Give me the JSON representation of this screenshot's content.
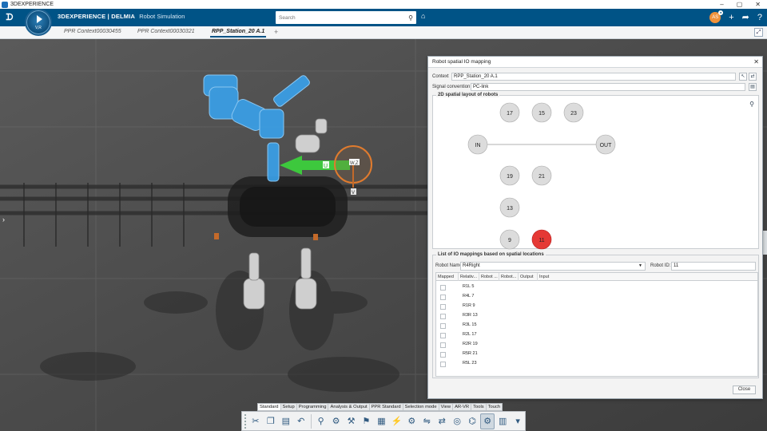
{
  "os": {
    "title": "3DEXPERIENCE",
    "min": "–",
    "max": "▢",
    "close": "✕"
  },
  "header": {
    "logo": "3DS",
    "brand_bold": "3DEXPERIENCE | DELMIA",
    "app_name": "Robot Simulation",
    "compass_label": "V,R",
    "search_placeholder": "Search",
    "avatar_initials": "AS",
    "icons": [
      "search-icon",
      "tag-icon",
      "add-icon",
      "share-icon",
      "help-icon"
    ]
  },
  "tabs": [
    {
      "label": "PPR Context00030455",
      "active": false
    },
    {
      "label": "PPR Context00030321",
      "active": false
    },
    {
      "label": "RPP_Station_20 A.1",
      "active": true
    }
  ],
  "viewport": {
    "arrow_label_left": "U",
    "arrow_label_right": "W,Z",
    "compass_label_below": "V"
  },
  "dialog": {
    "title": "Robot spatial IO mapping",
    "context_label": "Context",
    "context_value": "RPP_Station_20 A.1",
    "convention_label": "Signal convention",
    "convention_value": "PC-link",
    "layout_title": "2D spatial layout of robots",
    "nodes": [
      {
        "label": "17",
        "selected": false
      },
      {
        "label": "15",
        "selected": false
      },
      {
        "label": "23",
        "selected": false
      },
      {
        "label": "IN",
        "selected": false
      },
      {
        "label": "OUT",
        "selected": false
      },
      {
        "label": "19",
        "selected": false
      },
      {
        "label": "21",
        "selected": false
      },
      {
        "label": "13",
        "selected": false
      },
      {
        "label": "9",
        "selected": false
      },
      {
        "label": "11",
        "selected": true
      }
    ],
    "list_title": "List of IO mappings based on spatial locations",
    "robot_name_label": "Robot Name",
    "robot_name_value": "R4Right",
    "robot_id_label": "Robot ID:",
    "robot_id_value": "11",
    "columns": [
      "Mapped",
      "Relativ...",
      "Robot ...",
      "Robot...",
      "Output",
      "Input"
    ],
    "rows": [
      {
        "robot": "R1L",
        "id": "5",
        "mapped": false
      },
      {
        "robot": "R4L",
        "id": "7",
        "mapped": false
      },
      {
        "robot": "R1R",
        "id": "9",
        "mapped": false
      },
      {
        "robot": "R3R",
        "id": "13",
        "mapped": false
      },
      {
        "robot": "R3L",
        "id": "15",
        "mapped": false
      },
      {
        "robot": "R2L",
        "id": "17",
        "mapped": false
      },
      {
        "robot": "R2R",
        "id": "19",
        "mapped": false
      },
      {
        "robot": "R5R",
        "id": "21",
        "mapped": false
      },
      {
        "robot": "R5L",
        "id": "23",
        "mapped": false
      }
    ],
    "close_label": "Close"
  },
  "action_bar": {
    "tabs": [
      {
        "label": "Standard",
        "active": true
      },
      {
        "label": "Setup",
        "active": false
      },
      {
        "label": "Programming",
        "active": false
      },
      {
        "label": "Analysis & Output",
        "active": false
      },
      {
        "label": "PPR Standard",
        "active": false
      },
      {
        "label": "Selection mode",
        "active": false
      },
      {
        "label": "View",
        "active": false
      },
      {
        "label": "AR-VR",
        "active": false
      },
      {
        "label": "Tools",
        "active": false
      },
      {
        "label": "Touch",
        "active": false
      }
    ]
  },
  "colors": {
    "header_blue": "#005386",
    "selected_node": "#e53935",
    "node_fill": "#dcdcdc",
    "robot_highlight": "#3aa0e8",
    "arrow_green": "#3ccf3c"
  }
}
